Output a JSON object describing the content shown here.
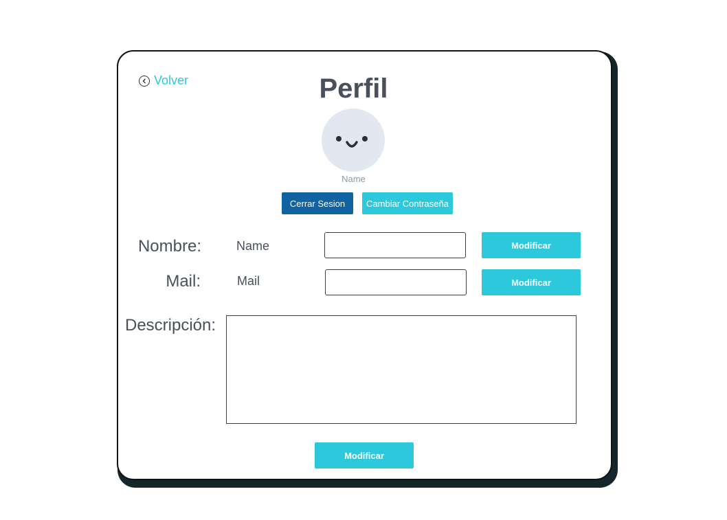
{
  "header": {
    "back_label": "Volver",
    "title": "Perfil"
  },
  "profile": {
    "name_caption": "Name"
  },
  "actions": {
    "logout_label": "Cerrar Sesion",
    "change_password_label": "Cambiar Contraseña"
  },
  "fields": {
    "nombre": {
      "label": "Nombre:",
      "value": "Name",
      "input_value": "",
      "button_label": "Modificar"
    },
    "mail": {
      "label": "Mail:",
      "value": "Mail",
      "input_value": "",
      "button_label": "Modificar"
    },
    "descripcion": {
      "label": "Descripción:",
      "input_value": ""
    }
  },
  "footer": {
    "submit_label": "Modificar"
  },
  "colors": {
    "accent": "#2ec8dc",
    "primary_dark": "#0f63a0",
    "text": "#48505e",
    "avatar_bg": "#e3e7ef"
  },
  "icons": {
    "back": "chevron-left-circle-icon",
    "avatar": "smiley-face-icon"
  }
}
